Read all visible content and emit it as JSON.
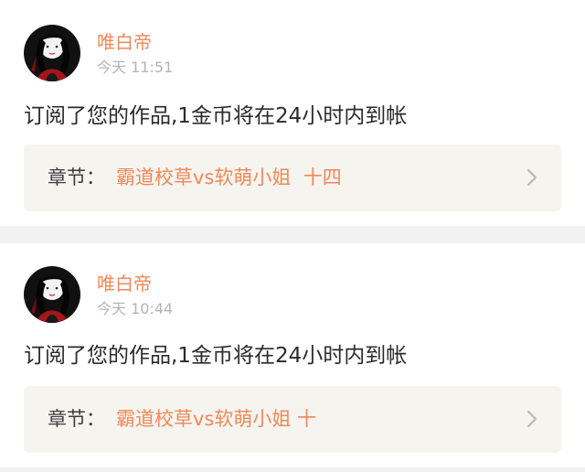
{
  "messages": [
    {
      "username": "唯白帝",
      "time": "今天 11:51",
      "text": "订阅了您的作品,1金币将在24小时内到帐",
      "chapter_prefix": "章节：",
      "chapter_title": "霸道校草vs软萌小姐  十四",
      "avatar_icon": "user-avatar",
      "chevron_icon": "chevron-right-icon"
    },
    {
      "username": "唯白帝",
      "time": "今天 10:44",
      "text": "订阅了您的作品,1金币将在24小时内到帐",
      "chapter_prefix": "章节：",
      "chapter_title": "霸道校草vs软萌小姐 十",
      "avatar_icon": "user-avatar",
      "chevron_icon": "chevron-right-icon"
    }
  ],
  "colors": {
    "accent": "#f0895a",
    "time": "#b4b4b4",
    "text": "#2b2b2b",
    "chapter_bg": "#f5f4ef",
    "page_bg": "#f2f2f2"
  }
}
